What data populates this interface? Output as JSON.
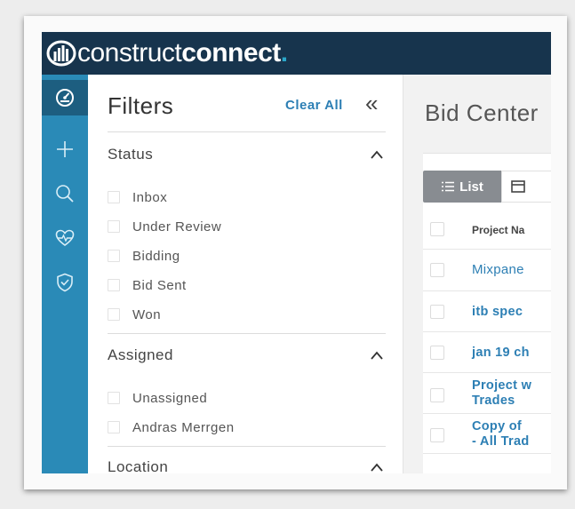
{
  "brand": {
    "light": "construct",
    "bold": "connect",
    "dot": ".",
    "accent": "#2aa7c9",
    "bar_color": "#17344d"
  },
  "rail": {
    "color": "#2a8ab7",
    "items": [
      {
        "icon": "dashboard-icon",
        "active": true
      },
      {
        "icon": "plus-icon"
      },
      {
        "icon": "search-icon"
      },
      {
        "icon": "heart-pulse-icon"
      },
      {
        "icon": "shield-check-icon"
      }
    ]
  },
  "filters": {
    "title": "Filters",
    "clear_all": "Clear All",
    "collapse": "«",
    "sections": {
      "status": {
        "title": "Status",
        "options": [
          "Inbox",
          "Under Review",
          "Bidding",
          "Bid Sent",
          "Won"
        ]
      },
      "assigned": {
        "title": "Assigned",
        "options": [
          "Unassigned",
          "Andras Merrgen"
        ]
      },
      "location": {
        "title": "Location"
      }
    }
  },
  "main": {
    "title": "Bid Center",
    "view_toggle": {
      "list_label": "List",
      "calendar_icon": "calendar-icon"
    },
    "table": {
      "column": "Project Na",
      "rows": [
        {
          "line1": "Mixpane",
          "line2": "",
          "bold": false
        },
        {
          "line1": "itb spec",
          "line2": "",
          "bold": true
        },
        {
          "line1": "jan 19 ch",
          "line2": "",
          "bold": true
        },
        {
          "line1": "Project w",
          "line2": "Trades",
          "bold": true
        },
        {
          "line1": "Copy of",
          "line2": "- All Trad",
          "bold": true
        }
      ]
    }
  }
}
